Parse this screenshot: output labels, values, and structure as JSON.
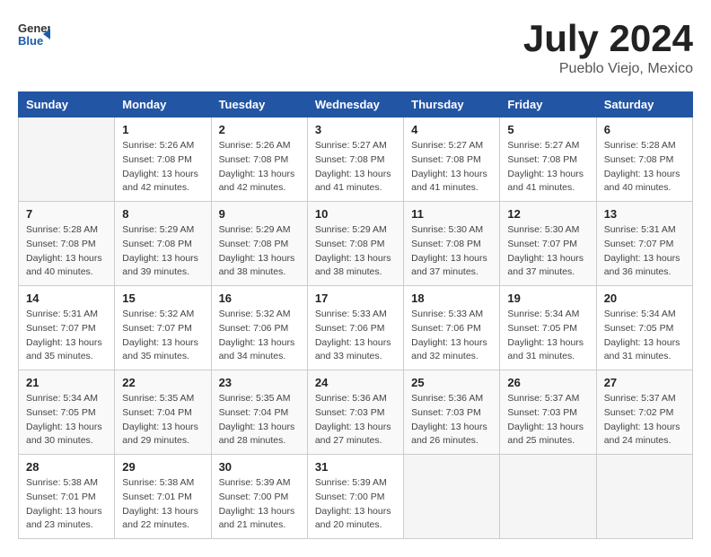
{
  "header": {
    "logo_general": "General",
    "logo_blue": "Blue",
    "month_year": "July 2024",
    "location": "Pueblo Viejo, Mexico"
  },
  "days_of_week": [
    "Sunday",
    "Monday",
    "Tuesday",
    "Wednesday",
    "Thursday",
    "Friday",
    "Saturday"
  ],
  "weeks": [
    [
      {
        "day": "",
        "sunrise": "",
        "sunset": "",
        "daylight": ""
      },
      {
        "day": "1",
        "sunrise": "Sunrise: 5:26 AM",
        "sunset": "Sunset: 7:08 PM",
        "daylight": "Daylight: 13 hours and 42 minutes."
      },
      {
        "day": "2",
        "sunrise": "Sunrise: 5:26 AM",
        "sunset": "Sunset: 7:08 PM",
        "daylight": "Daylight: 13 hours and 42 minutes."
      },
      {
        "day": "3",
        "sunrise": "Sunrise: 5:27 AM",
        "sunset": "Sunset: 7:08 PM",
        "daylight": "Daylight: 13 hours and 41 minutes."
      },
      {
        "day": "4",
        "sunrise": "Sunrise: 5:27 AM",
        "sunset": "Sunset: 7:08 PM",
        "daylight": "Daylight: 13 hours and 41 minutes."
      },
      {
        "day": "5",
        "sunrise": "Sunrise: 5:27 AM",
        "sunset": "Sunset: 7:08 PM",
        "daylight": "Daylight: 13 hours and 41 minutes."
      },
      {
        "day": "6",
        "sunrise": "Sunrise: 5:28 AM",
        "sunset": "Sunset: 7:08 PM",
        "daylight": "Daylight: 13 hours and 40 minutes."
      }
    ],
    [
      {
        "day": "7",
        "sunrise": "Sunrise: 5:28 AM",
        "sunset": "Sunset: 7:08 PM",
        "daylight": "Daylight: 13 hours and 40 minutes."
      },
      {
        "day": "8",
        "sunrise": "Sunrise: 5:29 AM",
        "sunset": "Sunset: 7:08 PM",
        "daylight": "Daylight: 13 hours and 39 minutes."
      },
      {
        "day": "9",
        "sunrise": "Sunrise: 5:29 AM",
        "sunset": "Sunset: 7:08 PM",
        "daylight": "Daylight: 13 hours and 38 minutes."
      },
      {
        "day": "10",
        "sunrise": "Sunrise: 5:29 AM",
        "sunset": "Sunset: 7:08 PM",
        "daylight": "Daylight: 13 hours and 38 minutes."
      },
      {
        "day": "11",
        "sunrise": "Sunrise: 5:30 AM",
        "sunset": "Sunset: 7:08 PM",
        "daylight": "Daylight: 13 hours and 37 minutes."
      },
      {
        "day": "12",
        "sunrise": "Sunrise: 5:30 AM",
        "sunset": "Sunset: 7:07 PM",
        "daylight": "Daylight: 13 hours and 37 minutes."
      },
      {
        "day": "13",
        "sunrise": "Sunrise: 5:31 AM",
        "sunset": "Sunset: 7:07 PM",
        "daylight": "Daylight: 13 hours and 36 minutes."
      }
    ],
    [
      {
        "day": "14",
        "sunrise": "Sunrise: 5:31 AM",
        "sunset": "Sunset: 7:07 PM",
        "daylight": "Daylight: 13 hours and 35 minutes."
      },
      {
        "day": "15",
        "sunrise": "Sunrise: 5:32 AM",
        "sunset": "Sunset: 7:07 PM",
        "daylight": "Daylight: 13 hours and 35 minutes."
      },
      {
        "day": "16",
        "sunrise": "Sunrise: 5:32 AM",
        "sunset": "Sunset: 7:06 PM",
        "daylight": "Daylight: 13 hours and 34 minutes."
      },
      {
        "day": "17",
        "sunrise": "Sunrise: 5:33 AM",
        "sunset": "Sunset: 7:06 PM",
        "daylight": "Daylight: 13 hours and 33 minutes."
      },
      {
        "day": "18",
        "sunrise": "Sunrise: 5:33 AM",
        "sunset": "Sunset: 7:06 PM",
        "daylight": "Daylight: 13 hours and 32 minutes."
      },
      {
        "day": "19",
        "sunrise": "Sunrise: 5:34 AM",
        "sunset": "Sunset: 7:05 PM",
        "daylight": "Daylight: 13 hours and 31 minutes."
      },
      {
        "day": "20",
        "sunrise": "Sunrise: 5:34 AM",
        "sunset": "Sunset: 7:05 PM",
        "daylight": "Daylight: 13 hours and 31 minutes."
      }
    ],
    [
      {
        "day": "21",
        "sunrise": "Sunrise: 5:34 AM",
        "sunset": "Sunset: 7:05 PM",
        "daylight": "Daylight: 13 hours and 30 minutes."
      },
      {
        "day": "22",
        "sunrise": "Sunrise: 5:35 AM",
        "sunset": "Sunset: 7:04 PM",
        "daylight": "Daylight: 13 hours and 29 minutes."
      },
      {
        "day": "23",
        "sunrise": "Sunrise: 5:35 AM",
        "sunset": "Sunset: 7:04 PM",
        "daylight": "Daylight: 13 hours and 28 minutes."
      },
      {
        "day": "24",
        "sunrise": "Sunrise: 5:36 AM",
        "sunset": "Sunset: 7:03 PM",
        "daylight": "Daylight: 13 hours and 27 minutes."
      },
      {
        "day": "25",
        "sunrise": "Sunrise: 5:36 AM",
        "sunset": "Sunset: 7:03 PM",
        "daylight": "Daylight: 13 hours and 26 minutes."
      },
      {
        "day": "26",
        "sunrise": "Sunrise: 5:37 AM",
        "sunset": "Sunset: 7:03 PM",
        "daylight": "Daylight: 13 hours and 25 minutes."
      },
      {
        "day": "27",
        "sunrise": "Sunrise: 5:37 AM",
        "sunset": "Sunset: 7:02 PM",
        "daylight": "Daylight: 13 hours and 24 minutes."
      }
    ],
    [
      {
        "day": "28",
        "sunrise": "Sunrise: 5:38 AM",
        "sunset": "Sunset: 7:01 PM",
        "daylight": "Daylight: 13 hours and 23 minutes."
      },
      {
        "day": "29",
        "sunrise": "Sunrise: 5:38 AM",
        "sunset": "Sunset: 7:01 PM",
        "daylight": "Daylight: 13 hours and 22 minutes."
      },
      {
        "day": "30",
        "sunrise": "Sunrise: 5:39 AM",
        "sunset": "Sunset: 7:00 PM",
        "daylight": "Daylight: 13 hours and 21 minutes."
      },
      {
        "day": "31",
        "sunrise": "Sunrise: 5:39 AM",
        "sunset": "Sunset: 7:00 PM",
        "daylight": "Daylight: 13 hours and 20 minutes."
      },
      {
        "day": "",
        "sunrise": "",
        "sunset": "",
        "daylight": ""
      },
      {
        "day": "",
        "sunrise": "",
        "sunset": "",
        "daylight": ""
      },
      {
        "day": "",
        "sunrise": "",
        "sunset": "",
        "daylight": ""
      }
    ]
  ]
}
